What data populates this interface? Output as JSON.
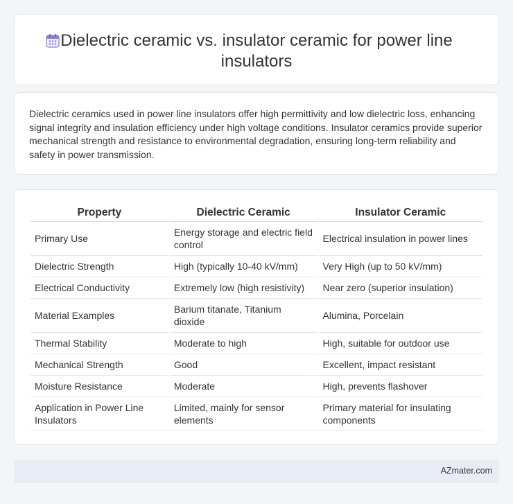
{
  "header": {
    "title": "Dielectric ceramic vs. insulator ceramic for power line insulators",
    "icon": "calendar-icon",
    "icon_color": "#8a7fd4"
  },
  "description": "Dielectric ceramics used in power line insulators offer high permittivity and low dielectric loss, enhancing signal integrity and insulation efficiency under high voltage conditions. Insulator ceramics provide superior mechanical strength and resistance to environmental degradation, ensuring long-term reliability and safety in power transmission.",
  "table": {
    "headers": [
      "Property",
      "Dielectric Ceramic",
      "Insulator Ceramic"
    ],
    "rows": [
      [
        "Primary Use",
        "Energy storage and electric field control",
        "Electrical insulation in power lines"
      ],
      [
        "Dielectric Strength",
        "High (typically 10-40 kV/mm)",
        "Very High (up to 50 kV/mm)"
      ],
      [
        "Electrical Conductivity",
        "Extremely low (high resistivity)",
        "Near zero (superior insulation)"
      ],
      [
        "Material Examples",
        "Barium titanate, Titanium dioxide",
        "Alumina, Porcelain"
      ],
      [
        "Thermal Stability",
        "Moderate to high",
        "High, suitable for outdoor use"
      ],
      [
        "Mechanical Strength",
        "Good",
        "Excellent, impact resistant"
      ],
      [
        "Moisture Resistance",
        "Moderate",
        "High, prevents flashover"
      ],
      [
        "Application in Power Line Insulators",
        "Limited, mainly for sensor elements",
        "Primary material for insulating components"
      ]
    ]
  },
  "footer": {
    "brand": "AZmater.com"
  }
}
